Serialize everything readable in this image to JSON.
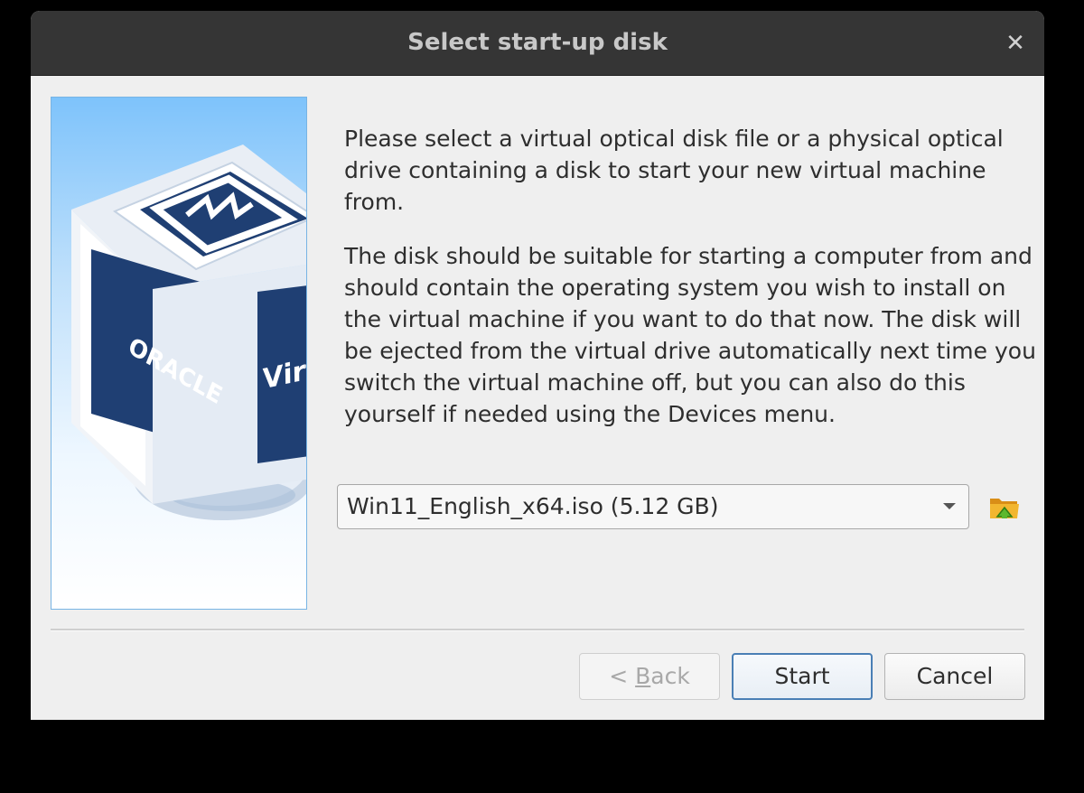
{
  "window": {
    "title": "Select start-up disk",
    "close_glyph": "✕"
  },
  "banner": {
    "logo_text": "ORACLE",
    "product_text_partial": "Virt"
  },
  "description": {
    "paragraph1": "Please select a virtual optical disk file or a physical optical drive containing a disk to start your new virtual machine from.",
    "paragraph2": "The disk should be suitable for starting a computer from and should contain the operating system you wish to install on the virtual machine if you want to do that now. The disk will be ejected from the virtual drive automatically next time you switch the virtual machine off, but you can also do this yourself if needed using the Devices menu."
  },
  "disk_select": {
    "selected_value": "Win11_English_x64.iso (5.12 GB)",
    "icon": "chevron-down-icon"
  },
  "folder_button": {
    "icon": "folder-open-icon"
  },
  "buttons": {
    "back_prefix": "< ",
    "back_mnemonic": "B",
    "back_rest": "ack",
    "start": "Start",
    "cancel": "Cancel"
  },
  "colors": {
    "titlebar": "#353535",
    "dialog_bg": "#efefef",
    "accent_border": "#4a7fb5",
    "banner_top": "#7ec3fb",
    "folder_yellow": "#f2b630",
    "folder_green": "#5cb82e"
  }
}
